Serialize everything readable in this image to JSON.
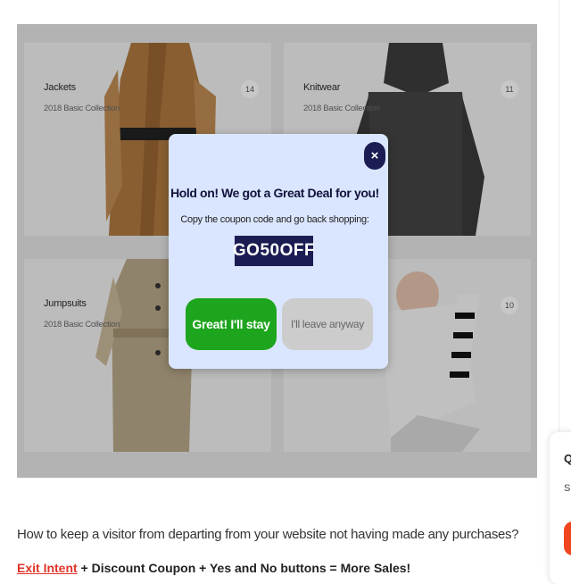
{
  "categories": [
    {
      "title": "Jackets",
      "subtitle": "2018 Basic Collection",
      "count": "14"
    },
    {
      "title": "Knitwear",
      "subtitle": "2018 Basic Collection",
      "count": "11"
    },
    {
      "title": "Jumpsuits",
      "subtitle": "2018 Basic Collection",
      "count": ""
    },
    {
      "title": "",
      "subtitle": "",
      "count": "10"
    }
  ],
  "popup": {
    "close_symbol": "×",
    "title": "Hold on! We got a Great Deal for you!",
    "subtitle": "Copy the coupon code and go back shopping:",
    "coupon_code": "GO50OFF",
    "stay_label": "Great! I'll stay",
    "leave_label": "I'll leave anyway",
    "colors": {
      "background": "#dae6ff",
      "dark": "#1b1d52",
      "stay": "#1ea51e",
      "leave": "#cccccc"
    }
  },
  "article": {
    "question": "How to keep a visitor from departing from your website not having made any purchases?",
    "highlight": "Exit Intent",
    "rest": " + Discount Coupon + Yes and No buttons = More Sales!"
  },
  "side_panel": {
    "letter": "Q",
    "small": "S"
  }
}
